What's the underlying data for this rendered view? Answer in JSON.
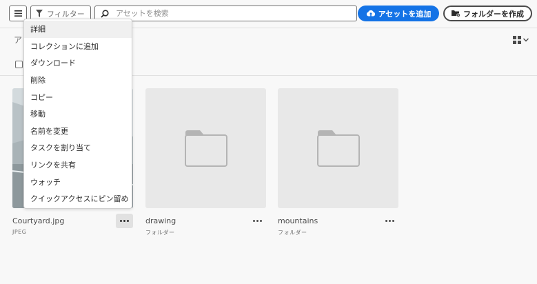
{
  "toolbar": {
    "menu_icon": "hamburger-icon",
    "filter_label": "フィルター",
    "filter_icon": "funnel-icon",
    "search_icon": "search-icon",
    "search_placeholder": "アセットを検索",
    "add_asset_label": "アセットを追加",
    "add_asset_icon": "cloud-upload-icon",
    "create_folder_label": "フォルダーを作成",
    "create_folder_icon": "folder-add-icon",
    "accent_color": "#1473e6"
  },
  "breadcrumb": {
    "text": "ア"
  },
  "view": {
    "icon": "grid-view-icon",
    "chevron": "chevron-down-icon"
  },
  "context_menu": {
    "items": [
      "詳細",
      "コレクションに追加",
      "ダウンロード",
      "削除",
      "コピー",
      "移動",
      "名前を変更",
      "タスクを割り当て",
      "リンクを共有",
      "ウォッチ",
      "クイックアクセスにピン留め"
    ]
  },
  "assets": [
    {
      "name": "Courtyard.jpg",
      "type": "JPEG",
      "kind": "image"
    },
    {
      "name": "drawing",
      "type": "フォルダー",
      "kind": "folder"
    },
    {
      "name": "mountains",
      "type": "フォルダー",
      "kind": "folder"
    }
  ],
  "more_icon": "more-horizontal-icon"
}
